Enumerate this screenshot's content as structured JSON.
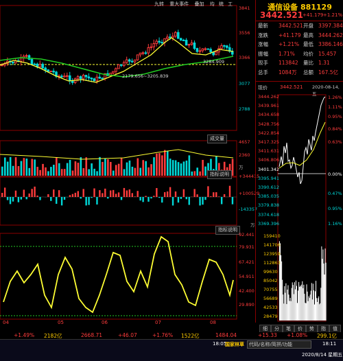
{
  "toolbar": {
    "items": [
      "九转",
      "重大事件",
      "叠加",
      "均",
      "统",
      "工"
    ]
  },
  "main_panel": {
    "price_axis": [
      "3841",
      "3556",
      "3366",
      "3077",
      "2788"
    ],
    "ma_label": "3284.909",
    "low_label": "2179.656~3205.839",
    "high_marker": "3841"
  },
  "volume_panel": {
    "button": "成交量",
    "axis": [
      "4657",
      "2360",
      "万"
    ]
  },
  "indicator1": {
    "button": "指标说明",
    "axis": [
      "+344415",
      "+100529",
      "-143357",
      "万"
    ]
  },
  "indicator2": {
    "button": "指标说明",
    "axis": [
      "92.441",
      "79.931",
      "67.421",
      "54.911",
      "42.400",
      "29.890"
    ]
  },
  "x_axis": [
    "04",
    "05",
    "06",
    "07",
    "08"
  ],
  "quote": {
    "title": "通信设备 881129",
    "price": "3442.521",
    "change": "+41.179",
    "change_pct": "+1.21%",
    "rows": [
      {
        "l1": "最新",
        "v1": "3442.521",
        "l2": "开盘",
        "v2": "3397.384"
      },
      {
        "l1": "涨跌",
        "v1": "+41.179",
        "l2": "最高",
        "v2": "3444.262"
      },
      {
        "l1": "涨幅",
        "v1": "+1.21%",
        "l2": "最低",
        "v2": "3386.146"
      },
      {
        "l1": "振幅",
        "v1": "1.71%",
        "l2": "均价",
        "v2": "15.457"
      },
      {
        "l1": "现手",
        "v1": "113842",
        "l2": "量比",
        "v2": "1.31"
      },
      {
        "l1": "总手",
        "v1": "1084万",
        "l2": "总额",
        "v2": "167.5亿"
      }
    ]
  },
  "intraday": {
    "label": "现价",
    "price": "3442.521",
    "date": "2020-08-14,五",
    "left_axis": [
      "3444.262",
      "3439.961",
      "3434.658",
      "3428.756",
      "3422.854",
      "3417.325",
      "3411.631",
      "3406.806",
      "3401.342",
      "3395.941",
      "3390.612",
      "3385.035",
      "3379.838",
      "3374.618",
      "3369.396"
    ],
    "right_axis": [
      "1.26%",
      "1.11%",
      "0.95%",
      "0.84%",
      "0.63%",
      "0.00%",
      "0.47%",
      "0.95%",
      "1.16%"
    ],
    "vol_axis": [
      "159410",
      "141706",
      "123959",
      "112863",
      "99630",
      "85042",
      "70755",
      "56689",
      "42533",
      "28479"
    ],
    "tabs": [
      "细",
      "分",
      "笔",
      "价",
      "势",
      "指",
      "值"
    ]
  },
  "bottom": {
    "items": [
      "+1.49%",
      "2182亿",
      "2668.71",
      "+46.07",
      "+1.76%",
      "1522亿",
      "1484.04",
      "+15.33",
      "+1.08%",
      "299.1亿"
    ]
  },
  "status": {
    "time1": "18:05",
    "ticker": "国家林草",
    "search_label": "代码/名称/简拼/功能",
    "time2": "18:11",
    "date_line": "2020/8/14 星期五"
  },
  "colors": {
    "up": "#ff3c3c",
    "down": "#00d8d8",
    "ma_yellow": "#ffff33",
    "ma_green": "#22cc22",
    "grid": "#8b0000",
    "quote_title": "#ffcc00"
  }
}
